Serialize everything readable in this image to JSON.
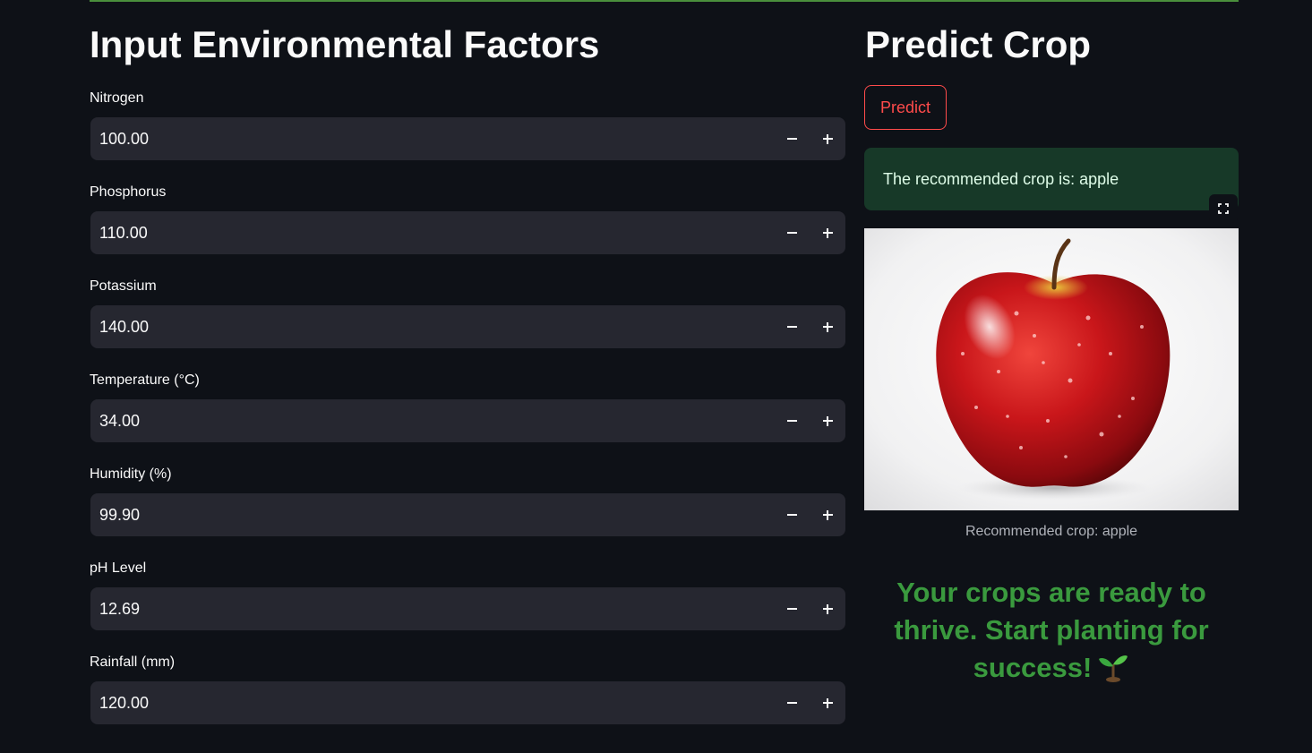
{
  "inputs_section": {
    "title": "Input Environmental Factors",
    "fields": [
      {
        "label": "Nitrogen",
        "value": "100.00"
      },
      {
        "label": "Phosphorus",
        "value": "110.00"
      },
      {
        "label": "Potassium",
        "value": "140.00"
      },
      {
        "label": "Temperature (°C)",
        "value": "34.00"
      },
      {
        "label": "Humidity (%)",
        "value": "99.90"
      },
      {
        "label": "pH Level",
        "value": "12.69"
      },
      {
        "label": "Rainfall (mm)",
        "value": "120.00"
      }
    ]
  },
  "predict_section": {
    "title": "Predict Crop",
    "predict_button": "Predict",
    "result_message": "The recommended crop is: apple",
    "image_caption": "Recommended crop: apple",
    "tagline": "Your crops are ready to thrive. Start planting for success!"
  },
  "colors": {
    "background": "#0e1117",
    "input_bg": "#262730",
    "accent_red": "#ff4b4b",
    "success_bg": "#173928",
    "tagline_green": "#3a9a3e"
  },
  "icons": {
    "minus": "minus-icon",
    "plus": "plus-icon",
    "fullscreen": "fullscreen-icon",
    "sprout": "seedling-icon"
  }
}
